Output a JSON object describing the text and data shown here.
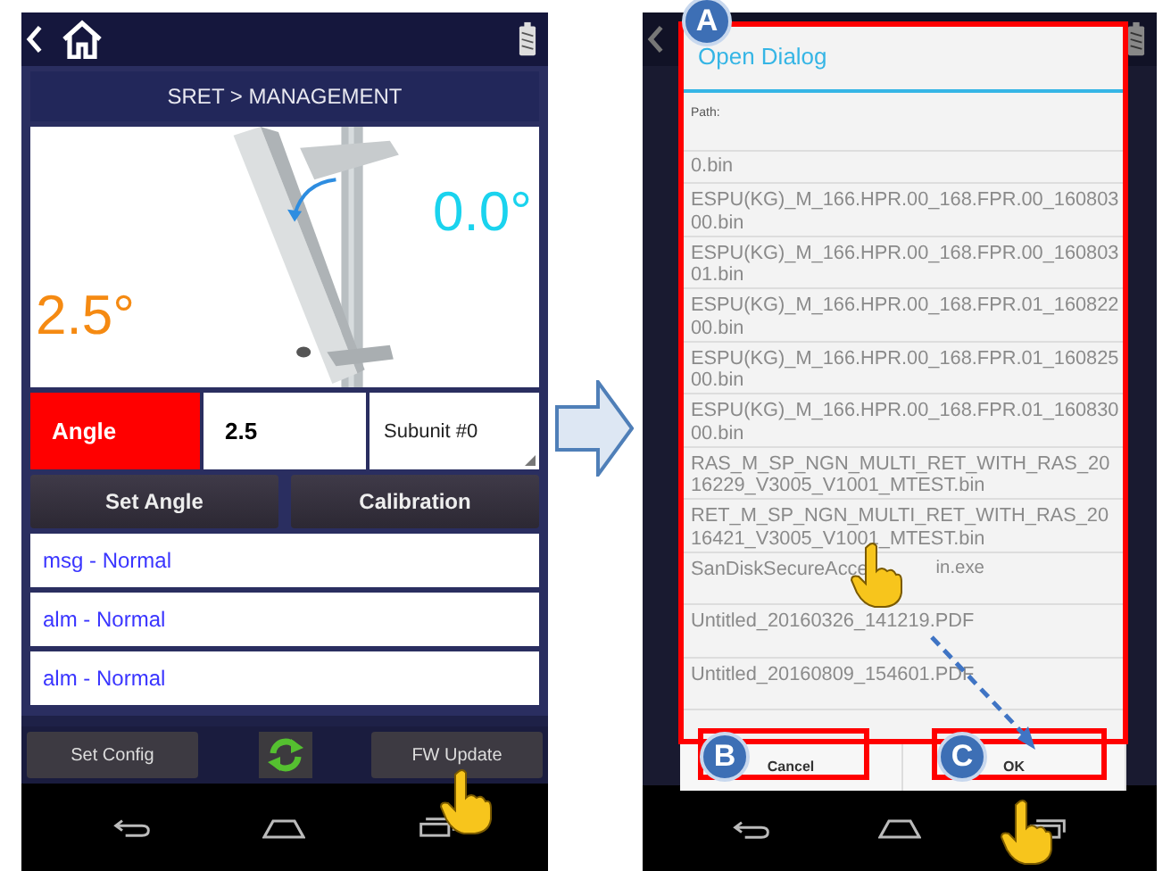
{
  "left_screen": {
    "title": "SRET > MANAGEMENT",
    "current_angle": "2.5°",
    "target_angle": "0.0°",
    "angle_label": "Angle",
    "angle_value": "2.5",
    "subunit": "Subunit #0",
    "buttons": [
      "Set Angle",
      "Calibration"
    ],
    "status_rows": [
      "msg - Normal",
      "alm - Normal",
      "alm - Normal"
    ],
    "bottom_buttons": [
      "Set Config",
      "FW Update"
    ]
  },
  "right_screen": {
    "dialog": {
      "title": "Open Dialog",
      "path_label": "Path:",
      "files": [
        {
          "label": "0.bin"
        },
        {
          "label": "ESPU(KG)_M_166.HPR.00_168.FPR.00_16080300.bin"
        },
        {
          "label": "ESPU(KG)_M_166.HPR.00_168.FPR.00_16080301.bin"
        },
        {
          "label": "ESPU(KG)_M_166.HPR.00_168.FPR.01_16082200.bin"
        },
        {
          "label": "ESPU(KG)_M_166.HPR.00_168.FPR.01_16082500.bin"
        },
        {
          "label": "ESPU(KG)_M_166.HPR.00_168.FPR.01_16083000.bin"
        },
        {
          "label": "RAS_M_SP_NGN_MULTI_RET_WITH_RAS_2016229_V3005_V1001_MTEST.bin"
        },
        {
          "label": "RET_M_SP_NGN_MULTI_RET_WITH_RAS_2016421_V3005_V1001_MTEST.bin"
        },
        {
          "label": "SanDiskSecureAcce",
          "label_after_cursor": "in.exe"
        },
        {
          "label": "Untitled_20160326_141219.PDF"
        },
        {
          "label": "Untitled_20160809_154601.PDF"
        }
      ],
      "buttons": [
        "Cancel",
        "OK"
      ]
    }
  },
  "callouts": [
    "A",
    "B",
    "C"
  ]
}
